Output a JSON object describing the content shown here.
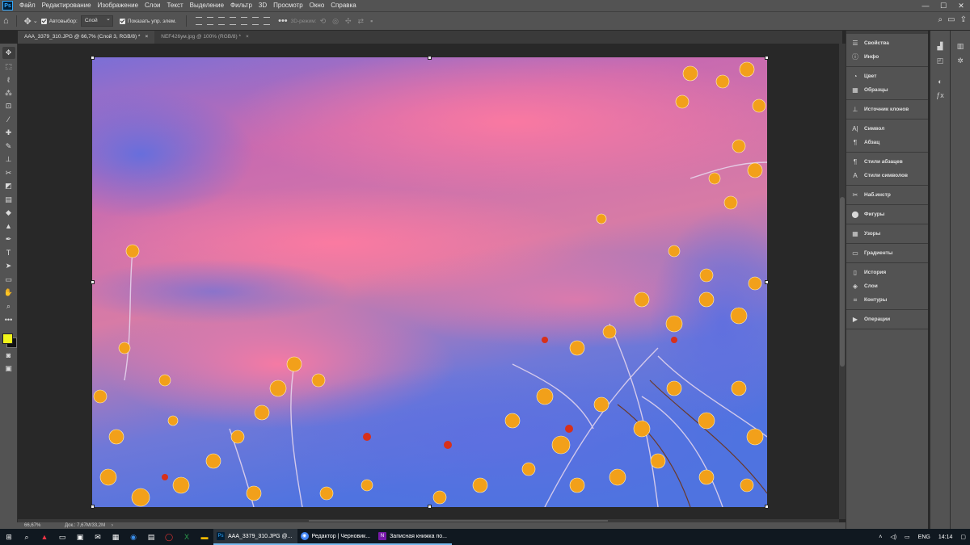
{
  "app": {
    "logo": "Ps"
  },
  "menu": [
    "Файл",
    "Редактирование",
    "Изображение",
    "Слои",
    "Текст",
    "Выделение",
    "Фильтр",
    "3D",
    "Просмотр",
    "Окно",
    "Справка"
  ],
  "window_controls": [
    "—",
    "☐",
    "✕"
  ],
  "options": {
    "auto_select_label": "Автовыбор:",
    "auto_select_value": "Слой",
    "show_transform_label": "Показать упр. элем.",
    "mode_3d_label": "3D-режим:"
  },
  "tabs": [
    {
      "label": "AAA_3379_310.JPG @ 66,7% (Слой 3, RGB/8) *",
      "close": "×"
    },
    {
      "label": "NEF426ум.jpg @ 100% (RGB/8) *",
      "close": "×"
    }
  ],
  "status": {
    "zoom": "66,67%",
    "doc": "Док.: 7,67M/33,2M",
    "arrow": "›"
  },
  "panels": [
    [
      {
        "icon": "☰",
        "label": "Свойства"
      },
      {
        "icon": "ⓘ",
        "label": "Инфо"
      }
    ],
    [
      {
        "icon": "◔",
        "label": "Цвет"
      },
      {
        "icon": "▦",
        "label": "Образцы"
      }
    ],
    [
      {
        "icon": "⊥",
        "label": "Источник клонов"
      }
    ],
    [
      {
        "icon": "A|",
        "label": "Символ"
      },
      {
        "icon": "¶",
        "label": "Абзац"
      }
    ],
    [
      {
        "icon": "¶",
        "label": "Стили абзацев"
      },
      {
        "icon": "A",
        "label": "Стили символов"
      }
    ],
    [
      {
        "icon": "✂",
        "label": "Наб.инстр"
      }
    ],
    [
      {
        "icon": "⬤",
        "label": "Фигуры"
      }
    ],
    [
      {
        "icon": "▦",
        "label": "Узоры"
      }
    ],
    [
      {
        "icon": "▭",
        "label": "Градиенты"
      }
    ],
    [
      {
        "icon": "▯",
        "label": "История"
      },
      {
        "icon": "◈",
        "label": "Слои"
      },
      {
        "icon": "⌗",
        "label": "Контуры"
      }
    ],
    [
      {
        "icon": "▶",
        "label": "Операции"
      }
    ]
  ],
  "taskbar": {
    "apps": [
      {
        "badge": "Ps",
        "badge_color": "#31a8ff",
        "badge_bg": "#001e36",
        "label": "AAA_3379_310.JPG @..."
      },
      {
        "badge": "◉",
        "badge_color": "#ffffff",
        "badge_bg": "#4285f4",
        "label": "Редактор | Черновик..."
      },
      {
        "badge": "N",
        "badge_color": "#ffffff",
        "badge_bg": "#7719aa",
        "label": "Записная книжка по..."
      }
    ],
    "lang": "ENG",
    "time": "14:14"
  }
}
